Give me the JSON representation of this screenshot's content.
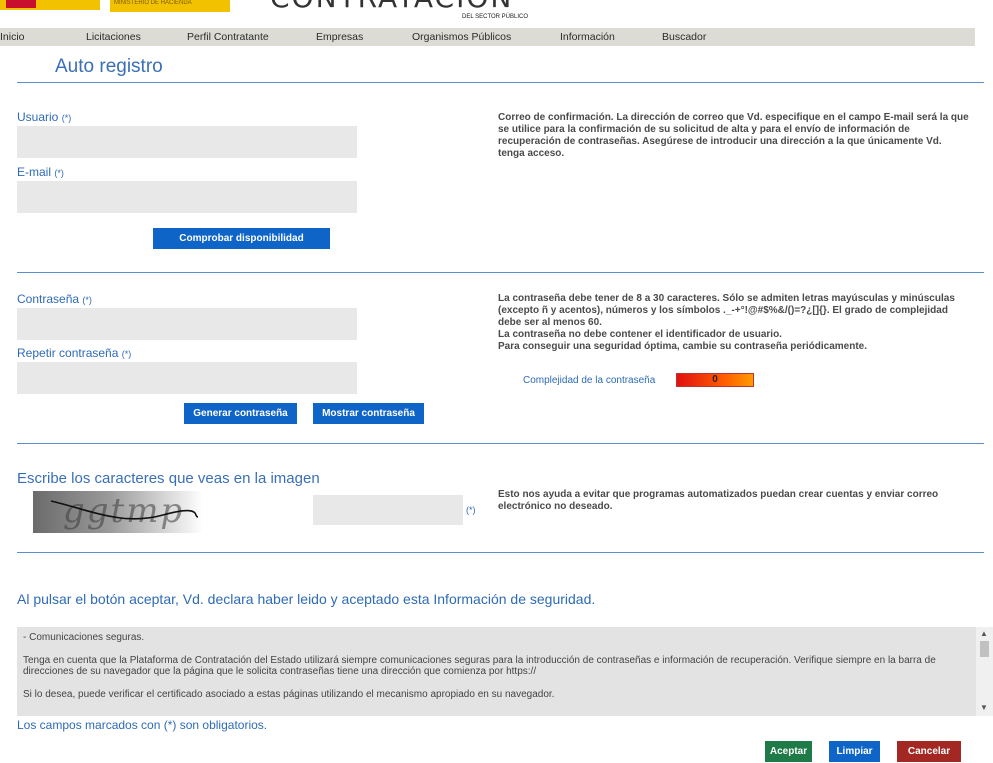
{
  "header": {
    "ministry_text": "MINISTERIO DE HACIENDA",
    "brand": "CONTRATACIÓN",
    "brand_sub": "DEL SECTOR PÚBLICO"
  },
  "nav": {
    "items": [
      {
        "label": "Inicio"
      },
      {
        "label": "Licitaciones"
      },
      {
        "label": "Perfil Contratante"
      },
      {
        "label": "Empresas"
      },
      {
        "label": "Organismos Públicos"
      },
      {
        "label": "Información"
      },
      {
        "label": "Buscador"
      }
    ]
  },
  "page_title": "Auto registro",
  "account": {
    "user_label": "Usuario",
    "email_label": "E-mail",
    "required_mark": "(*)",
    "check_button": "Comprobar disponibilidad",
    "help": "Correo de confirmación. La dirección de correo que Vd. especifique en el campo E-mail será la que se utilice para la confirmación de su solicitud de alta y para el envío de información de recuperación de contraseñas. Asegúrese de introducir una dirección a la que únicamente Vd. tenga acceso."
  },
  "password": {
    "password_label": "Contraseña",
    "repeat_label": "Repetir contraseña",
    "required_mark": "(*)",
    "generate_button": "Generar contraseña",
    "show_button": "Mostrar contraseña",
    "help_lines": [
      "La contraseña debe tener de 8 a 30 caracteres. Sólo se admiten letras mayúsculas y minúsculas (excepto ñ y acentos), números y los símbolos ._-+°!@#$%&/()=?¿[]{}. El grado de complejidad debe ser al menos 60.",
      "La contraseña no debe contener el identificador de usuario.",
      "Para conseguir una seguridad óptima, cambie su contraseña periódicamente."
    ],
    "complexity_label": "Complejidad de la contraseña",
    "complexity_value": "0"
  },
  "captcha": {
    "title": "Escribe los caracteres que veas en la imagen",
    "image_text": "ggtmp",
    "required_mark": "(*)",
    "help": "Esto nos ayuda a evitar que programas automatizados puedan crear cuentas y enviar correo electrónico no deseado."
  },
  "declaration": "Al pulsar el botón aceptar, Vd. declara haber leido y aceptado esta Información de seguridad.",
  "security_info": {
    "paragraphs": [
      "- Comunicaciones seguras.",
      "Tenga en cuenta que la Plataforma de Contratación del Estado utilizará siempre comunicaciones seguras para la introducción de contraseñas e información de recuperación. Verifique siempre en la barra de direcciones de su navegador que la página que le solicita contraseñas tiene una dirección que comienza por https://",
      "Si lo desea, puede verificar el certificado asociado a estas páginas utilizando el mecanismo apropiado en su navegador."
    ]
  },
  "required_note": "Los campos marcados con (*) son obligatorios.",
  "actions": {
    "accept": "Aceptar",
    "clear": "Limpiar",
    "cancel": "Cancelar"
  },
  "colors": {
    "accent_blue": "#0f64c8",
    "label_blue": "#2e6bb7",
    "accept_green": "#1e7a47",
    "cancel_red": "#a32824",
    "nav_bg": "#dcdcd4"
  }
}
